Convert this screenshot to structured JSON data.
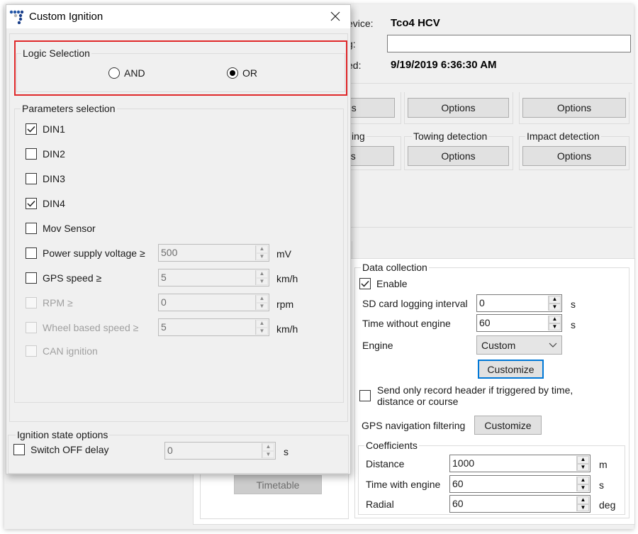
{
  "background_window": {
    "device_label": "evice:",
    "device_value": "Tco4 HCV",
    "name_label": "g:",
    "name_value": "",
    "modified_label": "ed:",
    "modified_value": "9/19/2019 6:36:30 AM",
    "feature_groups_row1": [
      {
        "title": "",
        "button": "ns"
      },
      {
        "title": "",
        "button": "Options"
      },
      {
        "title": "",
        "button": "Options"
      }
    ],
    "feature_groups_row2": [
      {
        "title": "ing",
        "button": "ns"
      },
      {
        "title": "Towing detection",
        "button": "Options"
      },
      {
        "title": "Impact detection",
        "button": "Options"
      }
    ],
    "timetable_button": "Timetable",
    "data_collection": {
      "title": "Data collection",
      "enable_label": "Enable",
      "enable_checked": true,
      "sd_logging_label": "SD card logging interval",
      "sd_logging_value": "0",
      "sd_logging_unit": "s",
      "time_without_engine_label": "Time without engine",
      "time_without_engine_value": "60",
      "time_without_engine_unit": "s",
      "engine_label": "Engine",
      "engine_value": "Custom",
      "customize_button": "Customize",
      "send_header_label_line1": "Send only record header if triggered by time,",
      "send_header_label_line2": "distance or course",
      "send_header_checked": false,
      "gps_filtering_label": "GPS navigation filtering",
      "gps_customize_button": "Customize",
      "coefficients": {
        "title": "Coefficients",
        "rows": [
          {
            "label": "Distance",
            "value": "1000",
            "unit": "m"
          },
          {
            "label": "Time with engine",
            "value": "60",
            "unit": "s"
          },
          {
            "label": "Radial",
            "value": "60",
            "unit": "deg"
          }
        ]
      }
    }
  },
  "dialog": {
    "title": "Custom Ignition",
    "logic_selection": {
      "title": "Logic Selection",
      "options": [
        {
          "label": "AND",
          "selected": false
        },
        {
          "label": "OR",
          "selected": true
        }
      ]
    },
    "parameters_selection": {
      "title": "Parameters selection",
      "items": [
        {
          "label": "DIN1",
          "checked": true,
          "enabled": true
        },
        {
          "label": "DIN2",
          "checked": false,
          "enabled": true
        },
        {
          "label": "DIN3",
          "checked": false,
          "enabled": true
        },
        {
          "label": "DIN4",
          "checked": true,
          "enabled": true
        },
        {
          "label": "Mov Sensor",
          "checked": false,
          "enabled": true
        },
        {
          "label": "Power supply voltage ≥",
          "checked": false,
          "enabled": true,
          "value": "500",
          "unit": "mV"
        },
        {
          "label": "GPS speed ≥",
          "checked": false,
          "enabled": true,
          "value": "5",
          "unit": "km/h"
        },
        {
          "label": "RPM ≥",
          "checked": false,
          "enabled": false,
          "value": "0",
          "unit": "rpm"
        },
        {
          "label": "Wheel based speed ≥",
          "checked": false,
          "enabled": false,
          "value": "5",
          "unit": "km/h"
        },
        {
          "label": "CAN ignition",
          "checked": false,
          "enabled": false
        }
      ]
    },
    "ignition_state_options": {
      "title": "Ignition state options",
      "switch_off_delay_label": "Switch OFF delay",
      "switch_off_delay_checked": false,
      "switch_off_delay_value": "0",
      "switch_off_delay_unit": "s"
    }
  },
  "colors": {
    "highlight": "#e0282a",
    "focus_border": "#0078d7",
    "window_bg": "#f0f0f0"
  }
}
